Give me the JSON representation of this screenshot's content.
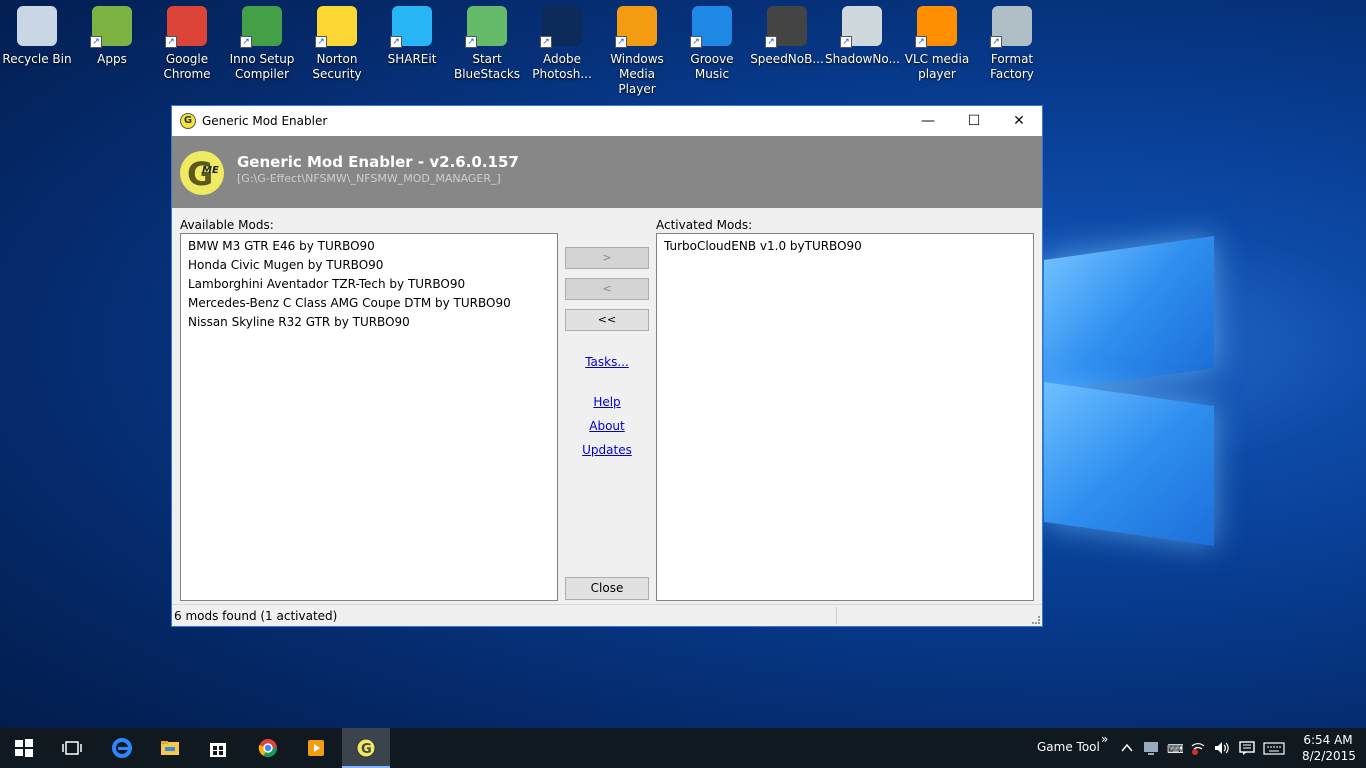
{
  "desktop": {
    "icons": [
      {
        "label": "Recycle Bin",
        "icon": "recycle-bin-icon",
        "color": "#c9d6e3"
      },
      {
        "label": "Apps",
        "icon": "android-apps-icon",
        "color": "#7cb342"
      },
      {
        "label": "Google Chrome",
        "icon": "chrome-icon",
        "color": "#db4437"
      },
      {
        "label": "Inno Setup Compiler",
        "icon": "inno-setup-icon",
        "color": "#43a047"
      },
      {
        "label": "Norton Security",
        "icon": "norton-icon",
        "color": "#fdd835"
      },
      {
        "label": "SHAREit",
        "icon": "shareit-icon",
        "color": "#29b6f6"
      },
      {
        "label": "Start BlueStacks",
        "icon": "bluestacks-icon",
        "color": "#66bb6a"
      },
      {
        "label": "Adobe Photosh...",
        "icon": "photoshop-icon",
        "color": "#0c2a5a"
      },
      {
        "label": "Windows Media Player",
        "icon": "media-player-icon",
        "color": "#f39c12"
      },
      {
        "label": "Groove Music",
        "icon": "groove-music-icon",
        "color": "#1e88e5"
      },
      {
        "label": "SpeedNoB...",
        "icon": "nfs-mw-icon",
        "color": "#444444"
      },
      {
        "label": "ShadowNo...",
        "icon": "shadow-icon",
        "color": "#cfd8dc"
      },
      {
        "label": "VLC media player",
        "icon": "vlc-icon",
        "color": "#ff8f00"
      },
      {
        "label": "Format Factory",
        "icon": "format-factory-icon",
        "color": "#b0bec5"
      }
    ]
  },
  "window": {
    "title": "Generic Mod Enabler",
    "banner_title": "Generic Mod Enabler - v2.6.0.157",
    "banner_path": "[G:\\G-Effect\\NFSMW\\_NFSMW_MOD_MANAGER_]",
    "logo_letter": "G",
    "logo_sub": "ME",
    "controls": {
      "minimize": "—",
      "maximize": "☐",
      "close": "✕"
    },
    "available_label": "Available Mods:",
    "activated_label": "Activated Mods:",
    "available_mods": [
      "BMW M3 GTR E46 by TURBO90",
      "Honda Civic Mugen by TURBO90",
      "Lamborghini Aventador TZR-Tech by TURBO90",
      "Mercedes-Benz C Class AMG Coupe DTM by TURBO90",
      "Nissan Skyline R32 GTR by TURBO90"
    ],
    "activated_mods": [
      "TurboCloudENB v1.0 byTURBO90"
    ],
    "buttons": {
      "add": ">",
      "remove": "<",
      "remove_all": "<<",
      "close": "Close"
    },
    "links": {
      "tasks": "Tasks...",
      "help": "Help",
      "about": "About",
      "updates": "Updates"
    },
    "status": "6 mods found (1 activated)"
  },
  "taskbar": {
    "tray_label": "Game Tool",
    "tray_chevron": "»",
    "time": "6:54 AM",
    "date": "8/2/2015",
    "accent": "#7fb6ff"
  }
}
